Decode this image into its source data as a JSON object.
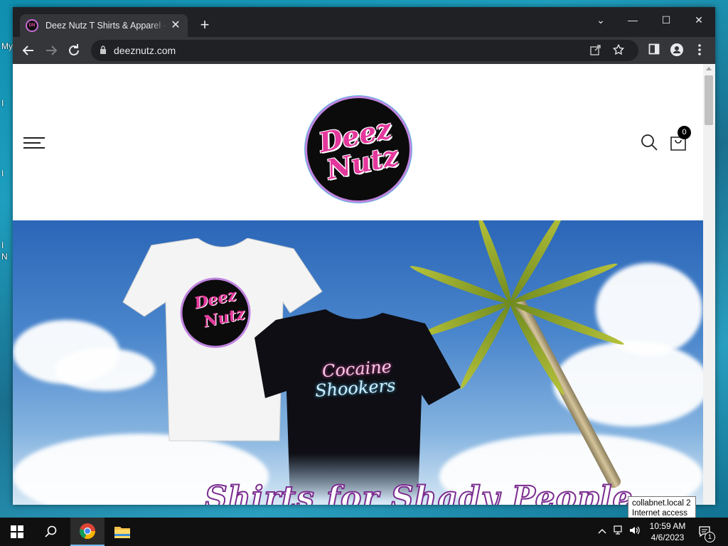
{
  "desktop": {
    "labels": [
      "My",
      "I",
      "I",
      "I",
      "N"
    ]
  },
  "browser": {
    "tab_title": "Deez Nutz T Shirts & Apparel - O",
    "tab_close": "✕",
    "new_tab": "+",
    "minimize": "—",
    "maximize": "☐",
    "close": "✕",
    "tab_search": "⌄",
    "url": "deeznutz.com"
  },
  "site": {
    "logo_line1": "Deez",
    "logo_line2": "Nutz",
    "cart_count": "0",
    "hero": {
      "shirt_logo_line1": "Deez",
      "shirt_logo_line2": "Nutz",
      "black_shirt_line1": "Cocaine",
      "black_shirt_line2": "Shookers",
      "tagline": "Shirts for Shady People"
    }
  },
  "tooltip": {
    "line1": "collabnet.local 2",
    "line2": "Internet access"
  },
  "taskbar": {
    "time": "10:59 AM",
    "date": "4/6/2023",
    "notification_count": "1"
  },
  "colors": {
    "brand_pink": "#e4379c",
    "brand_purple_ring": "#c084e0",
    "chrome_dark": "#202124",
    "chrome_toolbar": "#35363a"
  }
}
